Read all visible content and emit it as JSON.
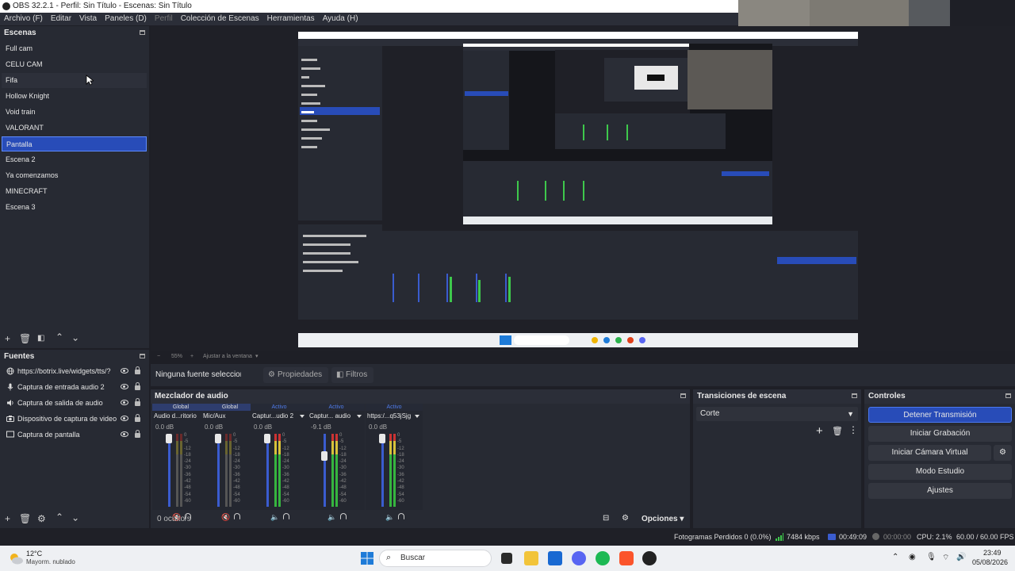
{
  "window": {
    "title": "OBS 32.2.1 - Perfil: Sin Título - Escenas: Sin Título"
  },
  "menu": [
    {
      "label": "Archivo (F)",
      "enabled": true
    },
    {
      "label": "Editar",
      "enabled": true
    },
    {
      "label": "Vista",
      "enabled": true
    },
    {
      "label": "Paneles (D)",
      "enabled": true
    },
    {
      "label": "Perfil",
      "enabled": false
    },
    {
      "label": "Colección de Escenas",
      "enabled": true
    },
    {
      "label": "Herramientas",
      "enabled": true
    },
    {
      "label": "Ayuda (H)",
      "enabled": true
    }
  ],
  "scenes": {
    "title": "Escenas",
    "items": [
      "Full cam",
      "CELU CAM",
      "Fifa",
      "Hollow Knight",
      "Void train",
      "VALORANT",
      "Pantalla",
      "Escena 2",
      "Ya comenzamos",
      "MINECRAFT",
      "Escena 3"
    ],
    "selected": "Pantalla"
  },
  "sources": {
    "title": "Fuentes",
    "items": [
      {
        "label": "https://botrix.live/widgets/tts/?",
        "icon": "globe-icon"
      },
      {
        "label": "Captura de entrada audio 2",
        "icon": "microphone-icon"
      },
      {
        "label": "Captura de salida de audio",
        "icon": "speaker-icon"
      },
      {
        "label": "Dispositivo de captura de video",
        "icon": "camera-icon"
      },
      {
        "label": "Captura de pantalla",
        "icon": "monitor-icon"
      }
    ]
  },
  "zoom": {
    "value": "55%",
    "fit_label": "Ajustar a la ventana"
  },
  "props": {
    "no_source": "Ninguna fuente seleccionada",
    "properties": "Propiedades",
    "filters": "Filtros"
  },
  "mixer": {
    "title": "Mezclador de audio",
    "channels": [
      {
        "state": "Global",
        "name": "Audio d...ritorio",
        "db": "0.0 dB",
        "level": 1.0,
        "muted": true
      },
      {
        "state": "Global",
        "name": "Mic/Aux",
        "db": "0.0 dB",
        "level": 1.0,
        "muted": true
      },
      {
        "state": "Activo",
        "name": "Captur...udio 2",
        "db": "0.0 dB",
        "level": 1.0,
        "muted": false
      },
      {
        "state": "Activo",
        "name": "Captur... audio",
        "db": "-9.1 dB",
        "level": 0.72,
        "muted": false
      },
      {
        "state": "Activo",
        "name": "https:/...q53jSjg",
        "db": "0.0 dB",
        "level": 1.0,
        "muted": false
      }
    ],
    "scale": [
      "0",
      "-5",
      "-12",
      "-18",
      "-24",
      "-30",
      "-36",
      "-42",
      "-48",
      "-54",
      "-60"
    ],
    "hidden": "0 oculto/s",
    "options": "Opciones"
  },
  "transitions": {
    "title": "Transiciones de escena",
    "selected": "Corte"
  },
  "controls": {
    "title": "Controles",
    "buttons": [
      "Detener Transmisión",
      "Iniciar Grabación",
      "Iniciar Cámara Virtual",
      "Modo Estudio",
      "Ajustes"
    ]
  },
  "status": {
    "dropped": "Fotogramas Perdidos 0 (0.0%)",
    "bitrate": "7484 kbps",
    "stream_time": "00:49:09",
    "rec_time": "00:00:00",
    "cpu": "CPU: 2.1%",
    "fps": "60.00 / 60.00 FPS"
  },
  "taskbar": {
    "weather_temp": "12°C",
    "weather_desc": "Mayorm. nublado",
    "search": "Buscar",
    "time": "23:49",
    "date": "05/08/2026"
  },
  "colors": {
    "accent": "#284cb8",
    "panel": "#272a33",
    "background": "#1e1f26"
  }
}
